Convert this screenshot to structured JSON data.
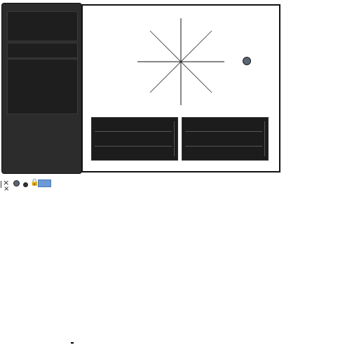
{
  "sidebar": {
    "blocks": [
      "top-block",
      "middle-block",
      "lower-block"
    ]
  },
  "main": {
    "compass_icon": "compass-icon",
    "knob_icon": "knob-icon",
    "panels": [
      "left-panel",
      "right-panel"
    ]
  },
  "tray": {
    "icons": [
      "close-icon",
      "globe-icon",
      "dot-icon",
      "lock-icon",
      "tag-icon"
    ]
  },
  "colors": {
    "sidebar_bg": "#2c2c2c",
    "panel_bg": "#1c1c1c",
    "accent": "#6a9bd4"
  }
}
